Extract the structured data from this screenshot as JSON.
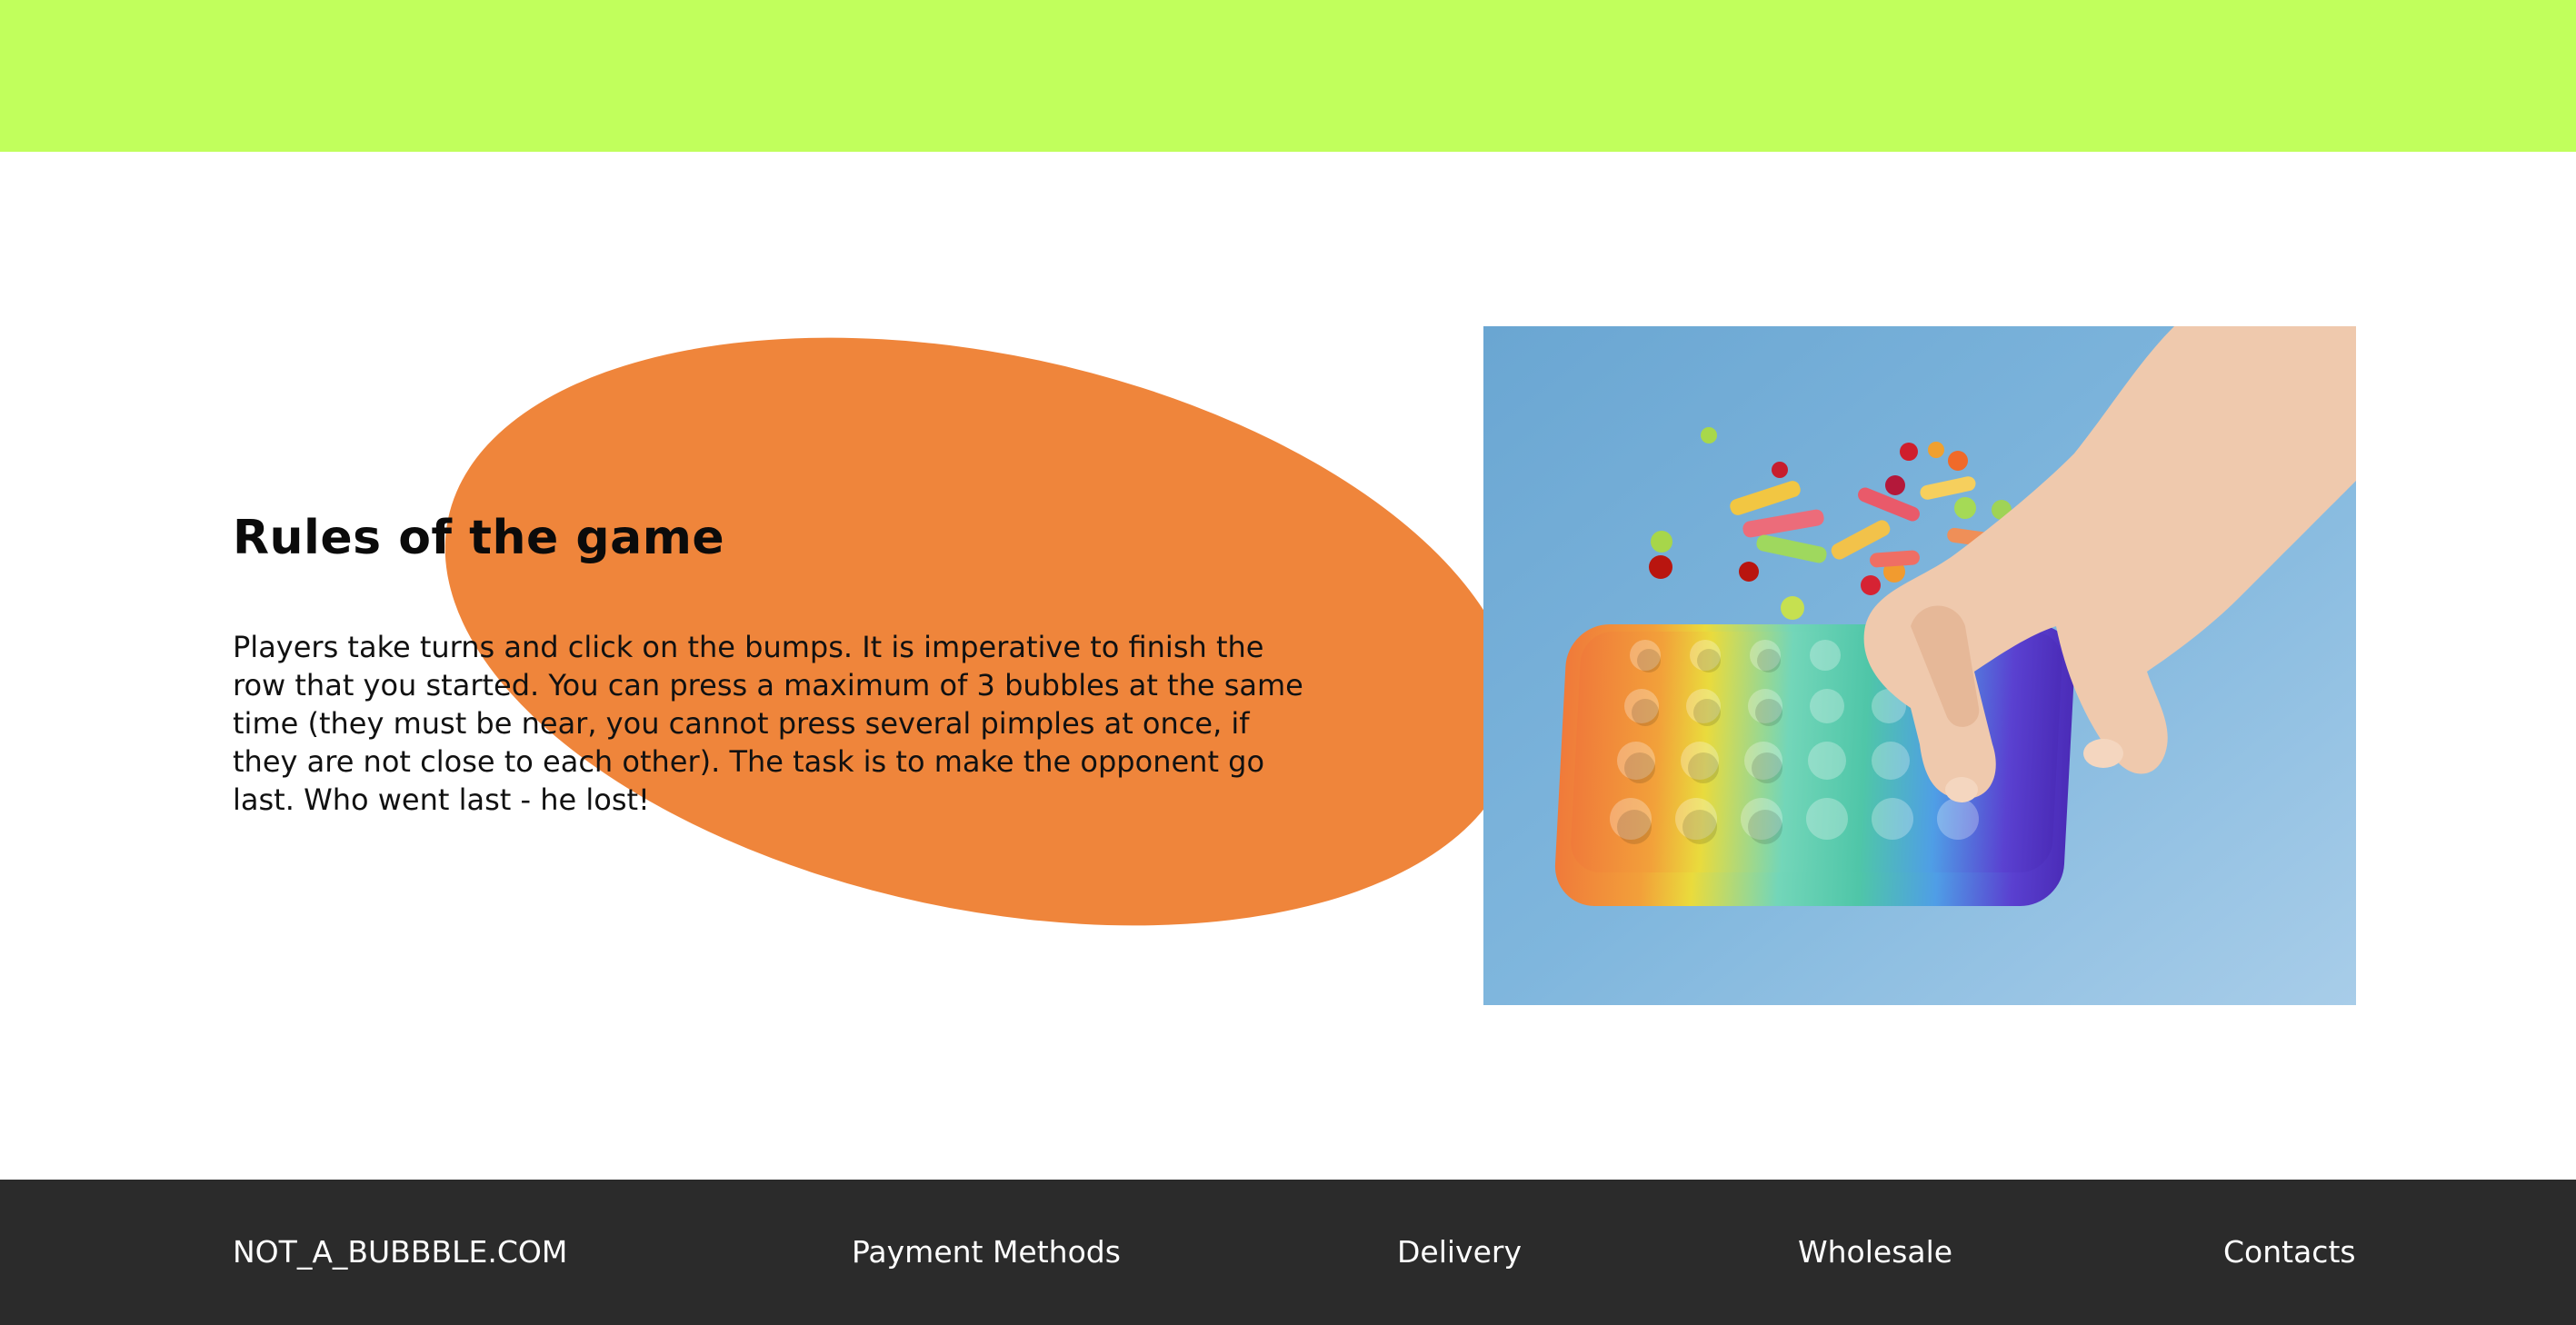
{
  "section": {
    "title": "Rules of the game",
    "body": "Players take turns and click on the bumps. It is imperative to finish the row that you started. You can press a maximum of 3 bubbles at the same time (they must be near, you cannot press several pimples at once, if they are not close to each other). The task is to make the opponent go last. Who went last - he lost!"
  },
  "colors": {
    "top_band": "#c1ff5c",
    "blob": "#ef853b",
    "footer_bg": "#2b2b2b",
    "photo_bg": "#7fb4dc"
  },
  "footer": {
    "brand": "NOT_A_BUBBBLE.COM",
    "links": [
      "Payment Methods",
      "Delivery",
      "Wholesale",
      "Contacts"
    ]
  }
}
